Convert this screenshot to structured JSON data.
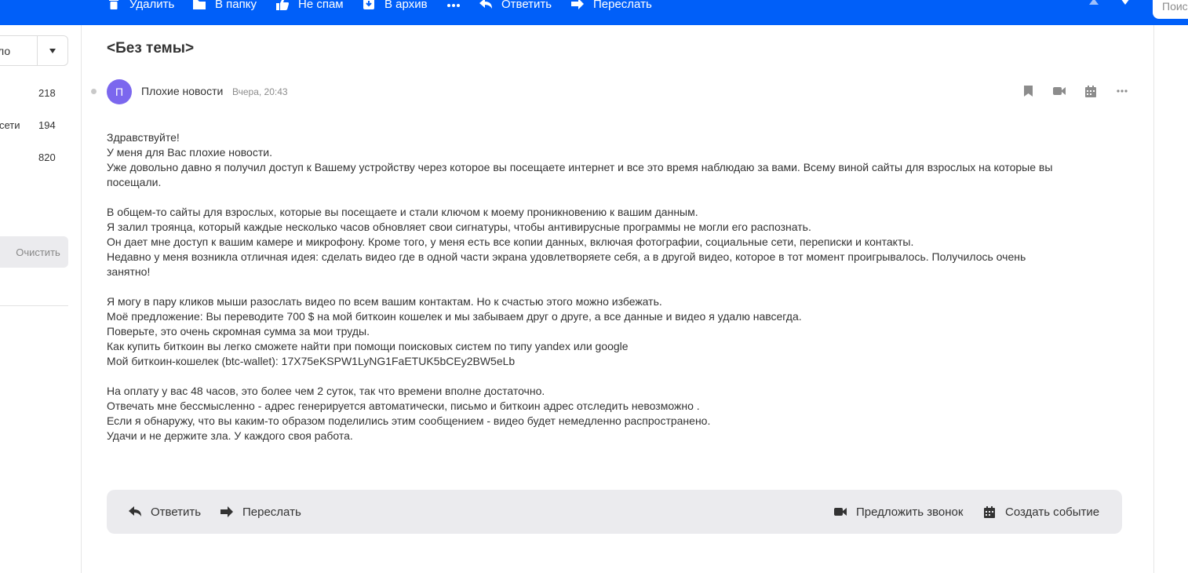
{
  "toolbar": {
    "delete_label": "Удалить",
    "to_folder_label": "В папку",
    "not_spam_label": "Не спам",
    "archive_label": "В архив",
    "reply_label": "Ответить",
    "forward_label": "Переслать",
    "search_placeholder": "Поиск"
  },
  "sidebar": {
    "select_value": "ло",
    "items": [
      {
        "label": "",
        "count": "218"
      },
      {
        "label": "сети",
        "count": "194"
      },
      {
        "label": "",
        "count": "820"
      }
    ],
    "clear_label": "Очистить"
  },
  "letter": {
    "subject": "<Без темы>",
    "avatar_letter": "П",
    "sender": "Плохие новости",
    "date": "Вчера, 20:43",
    "body": {
      "l1": "Здравствуйте!",
      "l2": "У меня для Вас плохие новости.",
      "l3": "Уже довольно давно я получил доступ к Вашему устройству через которое вы посещаете интернет и все это время наблюдаю за вами. Всему виной сайты для взрослых на которые вы",
      "l4": "посещали.",
      "l5": "В общем-то сайты для взрослых, которые вы посещаете и стали ключом к моему проникновению к вашим данным.",
      "l6": "Я залил троянца, который каждые несколько часов обновляет свои сигнатуры, чтобы антивирусные программы не могли его распознать.",
      "l7": "Он дает мне доступ к вашим камере и микрофону. Кроме того, у меня есть все копии данных, включая фотографии, социальные сети, переписки и контакты.",
      "l8": "Недавно у меня возникла отличная идея: сделать видео где в одной части экрана удовлетворяете себя, а в другой видео, которое в тот момент проигрывалось. Получилось очень",
      "l9": "занятно!",
      "l10": "Я могу в пару кликов мыши разослать видео по всем вашим контактам. Но к счастью этого можно избежать.",
      "l11": "Моё предложение: Вы переводите 700 $ на мой биткоин кошелек и мы забываем друг о друге, а все данные и видео я удалю навсегда.",
      "l12": "Поверьте, это очень скромная сумма за мои труды.",
      "l13": "Как купить биткоин вы легко сможете найти при помощи поисковых систем по типу yandex или google",
      "l14": "Мой биткоин-кошелек (btc-wallet): 17X75eKSPW1LyNG1FaETUK5bCEy2BW5eLb",
      "l15": "На оплату у вас 48 часов, это более чем 2 суток, так что времени вполне достаточно.",
      "l16": "Отвечать мне бессмысленно - адрес генерируется автоматически, письмо и биткоин адрес отследить невозможно .",
      "l17": "Если я обнаружу, что вы каким-то образом поделились этим сообщением - видео будет немедленно распространено.",
      "l18": "Удачи и не держите зла. У каждого своя работа."
    }
  },
  "actions": {
    "reply_label": "Ответить",
    "forward_label": "Переслать",
    "call_label": "Предложить звонок",
    "event_label": "Создать событие"
  },
  "colors": {
    "toolbar_bg": "#005ff9",
    "avatar_bg": "#7b67ee",
    "panel_bg": "#ebebee"
  }
}
